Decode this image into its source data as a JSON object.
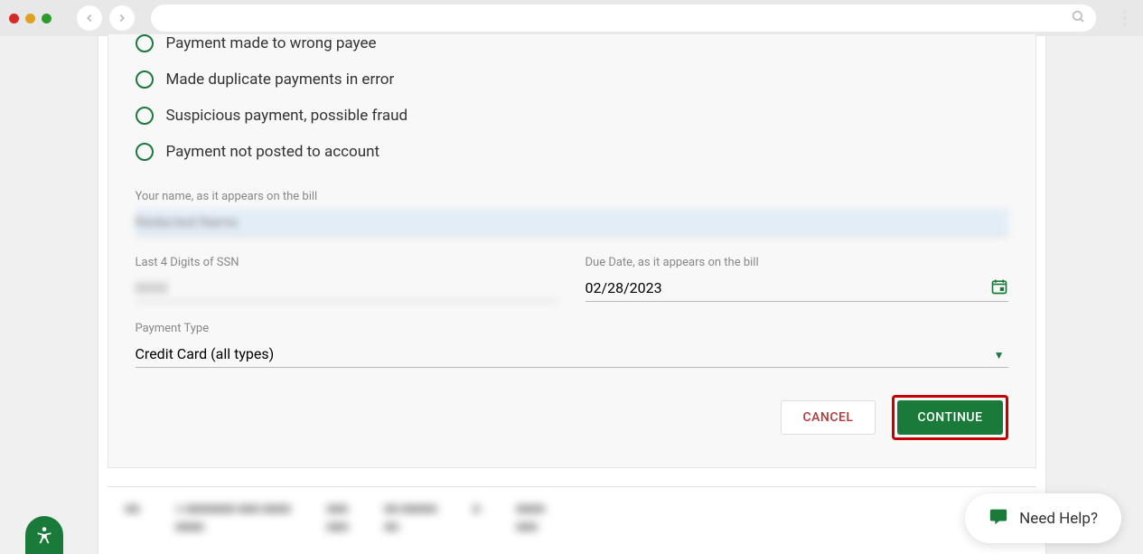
{
  "form": {
    "radios": [
      {
        "label": "Payment made to wrong payee"
      },
      {
        "label": "Made duplicate payments in error"
      },
      {
        "label": "Suspicious payment, possible fraud"
      },
      {
        "label": "Payment not posted to account"
      }
    ],
    "name_label": "Your name, as it appears on the bill",
    "name_value": "Redacted Name",
    "ssn_label": "Last 4 Digits of SSN",
    "ssn_value": "0000",
    "due_label": "Due Date, as it appears on the bill",
    "due_value": "02/28/2023",
    "ptype_label": "Payment Type",
    "ptype_value": "Credit Card (all types)",
    "cancel": "CANCEL",
    "continue": "CONTINUE"
  },
  "help": {
    "label": "Need Help?"
  },
  "colors": {
    "accent": "#1a7a3a",
    "danger": "#b23a3a",
    "highlight_border": "#c40000"
  }
}
